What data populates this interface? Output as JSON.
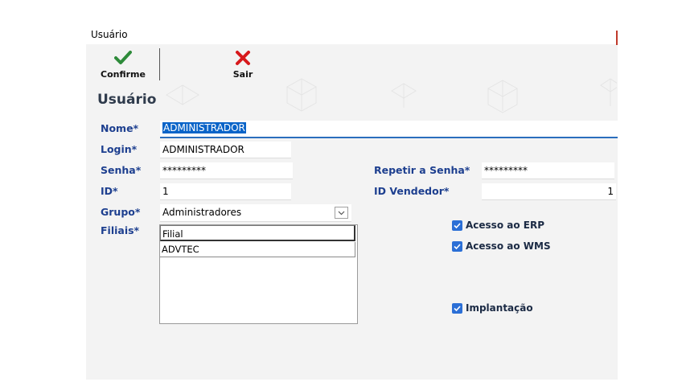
{
  "window": {
    "title": "Usuário"
  },
  "toolbar": {
    "confirm_label": "Confirme",
    "exit_label": "Sair",
    "confirm_color": "#2e8b3a",
    "exit_color": "#d7191c"
  },
  "form": {
    "heading": "Usuário",
    "nome": {
      "label": "Nome*",
      "value": "ADMINISTRADOR"
    },
    "login": {
      "label": "Login*",
      "value": "ADMINISTRADOR"
    },
    "senha": {
      "label": "Senha*",
      "value": "*********"
    },
    "repetir_senha": {
      "label": "Repetir a Senha*",
      "value": "*********"
    },
    "id": {
      "label": "ID*",
      "value": "1"
    },
    "id_vendedor": {
      "label": "ID Vendedor*",
      "value": "1"
    },
    "grupo": {
      "label": "Grupo*",
      "selected": "Administradores"
    },
    "filiais": {
      "label": "Filiais*",
      "column_header": "Filial",
      "rows": [
        "ADVTEC"
      ]
    }
  },
  "options": {
    "acesso_erp": {
      "label": "Acesso ao ERP",
      "checked": true
    },
    "acesso_wms": {
      "label": "Acesso ao WMS",
      "checked": true
    },
    "implantacao": {
      "label": "Implantação",
      "checked": true
    }
  },
  "colors": {
    "label_blue": "#1d3f8f",
    "selection_blue": "#0a64c8",
    "checkbox_blue": "#2b6fd6",
    "panel_bg": "#f3f3f3"
  }
}
